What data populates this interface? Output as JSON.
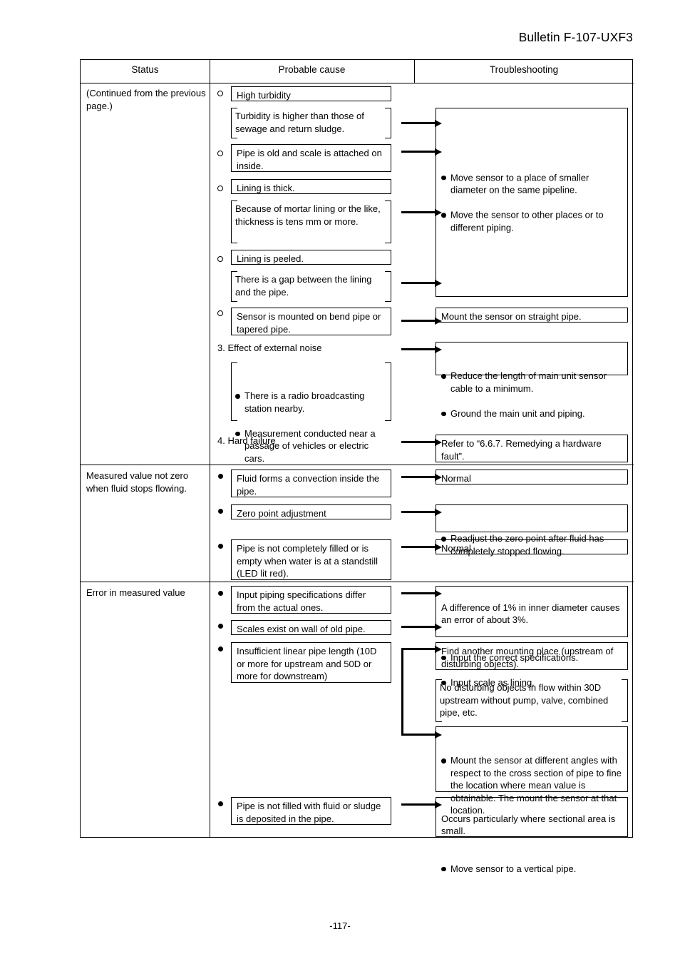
{
  "document": {
    "bulletin_title": "Bulletin F-107-UXF3",
    "page_number": "-117-"
  },
  "table": {
    "headers": {
      "status": "Status",
      "probable_cause": "Probable cause",
      "troubleshooting": "Troubleshooting"
    },
    "sections": [
      {
        "status": "(Continued from the previous page.)",
        "marker_type": "open-circle",
        "causes": [
          "High turbidity",
          "Turbidity is higher than those of sewage and return sludge.",
          "Pipe is old and scale is attached on inside.",
          "Lining is thick.",
          "Because of mortar lining or the like, thickness is tens mm or more.",
          "Lining is peeled.",
          "There is a gap between the lining and the pipe.",
          "Sensor is mounted on bend pipe or tapered pipe.",
          "3. Effect of external noise",
          "There is a radio broadcasting station nearby.",
          "Measurement conducted near a passage of vehicles or electric cars.",
          "4. Hard failure"
        ],
        "troubleshooting": [
          "Move sensor to a place of smaller diameter on the same pipeline.",
          "Move the sensor to other places or to different piping.",
          "Mount the sensor on straight pipe.",
          "Reduce the length of main unit sensor cable to a minimum.",
          "Ground the main unit and piping.",
          "Refer to “6.6.7. Remedying a hardware fault”."
        ]
      },
      {
        "status": "Measured value not zero when fluid stops flowing.",
        "marker_type": "filled-dot",
        "causes": [
          "Fluid forms a convection inside the pipe.",
          "Zero point adjustment",
          "Pipe is not completely filled or is empty when water is at a standstill (LED lit red)."
        ],
        "troubleshooting": [
          "Normal",
          "Readjust the zero point after fluid has completely stopped flowing.",
          "Normal"
        ]
      },
      {
        "status": "Error in measured value",
        "marker_type": "filled-dot",
        "causes": [
          "Input piping specifications differ from the actual ones.",
          "Scales exist on wall of old pipe.",
          "Insufficient linear pipe length (10D or more for upstream and 50D or more for downstream)",
          "Pipe is not filled with fluid or sludge is deposited in the pipe."
        ],
        "troubleshooting": [
          "A difference of 1% in inner diameter causes an error of about 3%.",
          "Input the correct specifications.",
          "Input scale as lining.",
          "Find another mounting place (upstream of disturbing objects).",
          "No disturbing objects in flow within 30D upstream without pump, valve, combined pipe, etc.",
          "Mount the sensor at different angles with respect to the cross section of pipe to fine the location where mean value is obtainable. The mount the sensor at that location.",
          "Occurs particularly where sectional area is small.",
          "Move sensor to a vertical pipe."
        ]
      }
    ]
  }
}
